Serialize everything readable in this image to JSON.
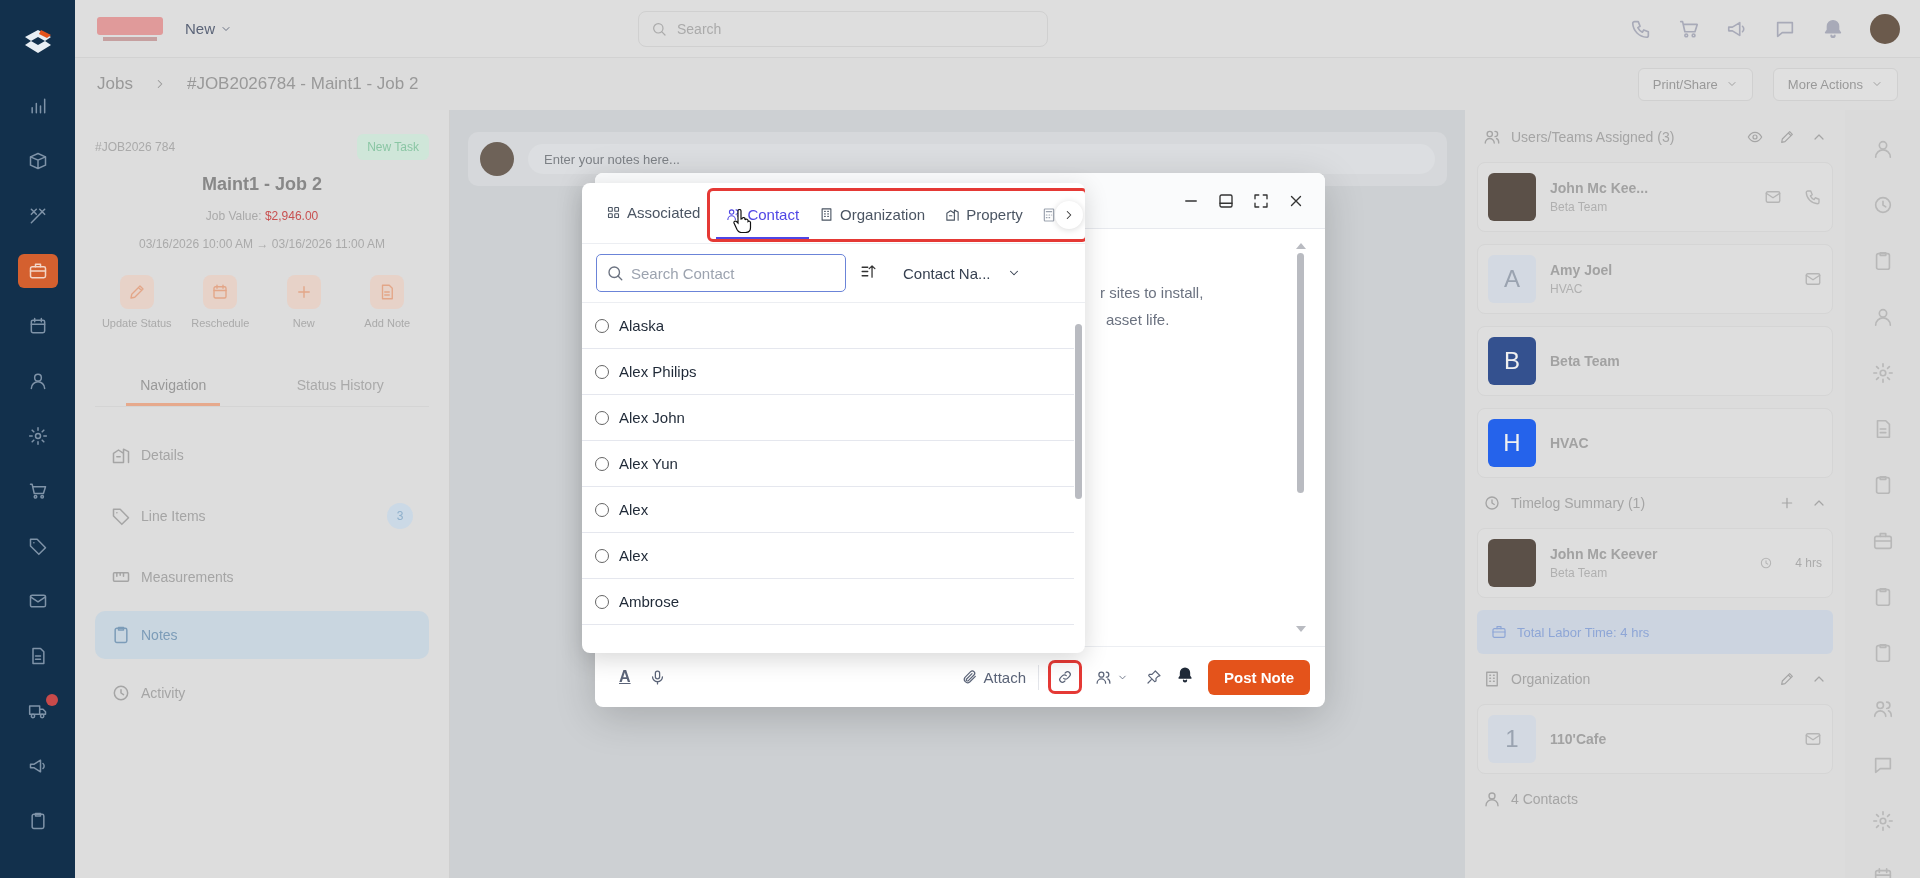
{
  "nav_rail": {
    "items": [
      {
        "selected": false
      },
      {
        "selected": false
      },
      {
        "selected": false
      },
      {
        "selected": true
      },
      {
        "selected": false
      },
      {
        "selected": false
      },
      {
        "selected": false
      },
      {
        "selected": false
      },
      {
        "selected": false
      },
      {
        "selected": false
      },
      {
        "selected": false
      },
      {
        "selected": false,
        "badge": true
      },
      {
        "selected": false
      },
      {
        "selected": false
      }
    ]
  },
  "top_bar": {
    "menu": "New",
    "search_placeholder": "Search"
  },
  "breadcrumb": {
    "items": [
      "Jobs",
      "#JOB2026784 - Maint1 - Job 2"
    ],
    "actions": [
      "Print/Share",
      "More Actions"
    ]
  },
  "job_card": {
    "number": "#JOB2026 784",
    "status": "New Task",
    "title": "Maint1 - Job 2",
    "value_label": "Job Value:",
    "value": "$2,946.00",
    "schedule": "03/16/2026 10:00 AM → 03/16/2026 11:00 AM",
    "quick_actions": [
      "Update Status",
      "Reschedule",
      "New",
      "Add Note"
    ]
  },
  "panel_tabs": [
    {
      "label": "Navigation",
      "selected": true
    },
    {
      "label": "Status History",
      "selected": false
    }
  ],
  "nav_items": [
    {
      "label": "Details",
      "selected": false
    },
    {
      "label": "Line Items",
      "count": "3",
      "selected": false
    },
    {
      "label": "Measurements",
      "selected": false
    },
    {
      "label": "Notes",
      "selected": true
    },
    {
      "label": "Activity",
      "selected": false
    }
  ],
  "note_composer": {
    "placeholder": "Enter your notes here..."
  },
  "editor": {
    "lines": [
      "r sites to install,",
      "asset life."
    ],
    "format_glyph": "A",
    "attach": "Attach",
    "link_highlighted": true,
    "post": "Post Note"
  },
  "picker": {
    "tabs_highlighted": true,
    "tabs": [
      {
        "label": "Associated",
        "selected": false
      },
      {
        "label": "Contact",
        "selected": true
      },
      {
        "label": "Organization",
        "selected": false
      },
      {
        "label": "Property",
        "selected": false
      }
    ],
    "search_placeholder": "Search Contact",
    "sort": "Contact Na...",
    "contacts": [
      {
        "name": "Alaska",
        "selected": false
      },
      {
        "name": "Alex Philips",
        "selected": false
      },
      {
        "name": "Alex John",
        "selected": false
      },
      {
        "name": "Alex Yun",
        "selected": false
      },
      {
        "name": "Alex",
        "selected": false
      },
      {
        "name": "Alex",
        "selected": false
      },
      {
        "name": "Ambrose",
        "selected": false
      }
    ]
  },
  "assigned": {
    "title": "Users/Teams Assigned (3)",
    "members": [
      {
        "kind": "photo",
        "name": "John Mc Kee...",
        "team": "Beta Team"
      },
      {
        "kind": "initial",
        "initial": "A",
        "name": "Amy Joel",
        "team": "HVAC",
        "color": "#d3d9e2"
      },
      {
        "kind": "initial",
        "initial": "B",
        "name": "Beta Team",
        "color": "#34518f"
      },
      {
        "kind": "initial",
        "initial": "H",
        "name": "HVAC",
        "color": "#2563eb"
      }
    ]
  },
  "timelog": {
    "title": "Timelog Summary (1)",
    "name": "John Mc Keever",
    "team": "Beta Team",
    "hours": "4 hrs",
    "total": "Total Labor Time: 4 hrs"
  },
  "organization": {
    "title": "Organization",
    "initial": "1",
    "name": "110'Cafe",
    "contacts": "4 Contacts"
  }
}
